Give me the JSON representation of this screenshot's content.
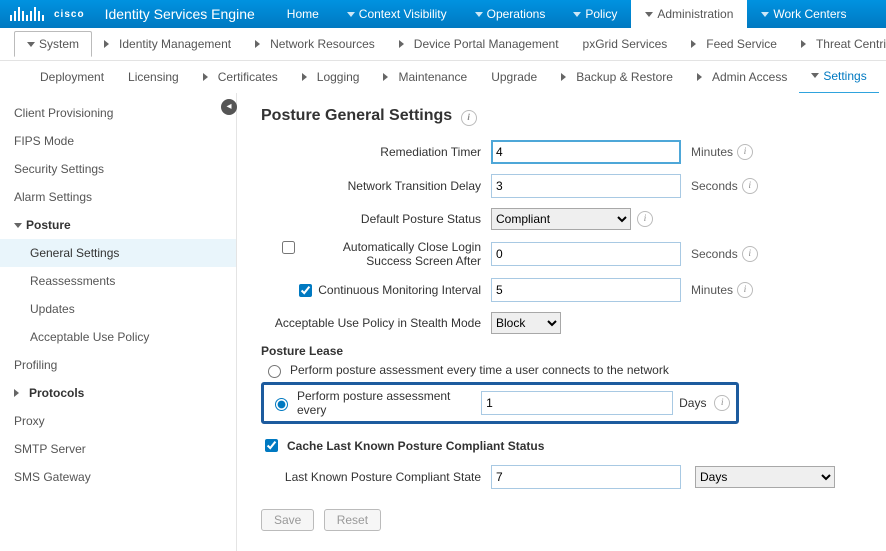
{
  "brand": {
    "vendor": "cisco",
    "product": "Identity Services Engine"
  },
  "topnav": {
    "items": [
      "Home",
      "Context Visibility",
      "Operations",
      "Policy",
      "Administration",
      "Work Centers"
    ],
    "active": "Administration"
  },
  "subnav": {
    "items": [
      "System",
      "Identity Management",
      "Network Resources",
      "Device Portal Management",
      "pxGrid Services",
      "Feed Service",
      "Threat Centric NAC"
    ],
    "active": "System",
    "dropdowns": [
      true,
      true,
      true,
      true,
      false,
      true,
      true
    ]
  },
  "ternav": {
    "items": [
      "Deployment",
      "Licensing",
      "Certificates",
      "Logging",
      "Maintenance",
      "Upgrade",
      "Backup & Restore",
      "Admin Access",
      "Settings"
    ],
    "active": "Settings",
    "dropdowns": [
      false,
      false,
      true,
      true,
      true,
      false,
      true,
      true,
      true
    ]
  },
  "sidebar": {
    "items": [
      {
        "label": "Client Provisioning",
        "type": "item"
      },
      {
        "label": "FIPS Mode",
        "type": "item"
      },
      {
        "label": "Security Settings",
        "type": "item"
      },
      {
        "label": "Alarm Settings",
        "type": "item"
      },
      {
        "label": "Posture",
        "type": "group",
        "expanded": true,
        "children": [
          {
            "label": "General Settings",
            "active": true
          },
          {
            "label": "Reassessments"
          },
          {
            "label": "Updates"
          },
          {
            "label": "Acceptable Use Policy"
          }
        ]
      },
      {
        "label": "Profiling",
        "type": "item"
      },
      {
        "label": "Protocols",
        "type": "group",
        "expanded": false
      },
      {
        "label": "Proxy",
        "type": "item"
      },
      {
        "label": "SMTP Server",
        "type": "item"
      },
      {
        "label": "SMS Gateway",
        "type": "item"
      }
    ]
  },
  "page": {
    "title": "Posture General Settings",
    "fields": {
      "remediation_timer": {
        "label": "Remediation Timer",
        "value": "4",
        "unit": "Minutes"
      },
      "network_transition_delay": {
        "label": "Network Transition Delay",
        "value": "3",
        "unit": "Seconds"
      },
      "default_posture_status": {
        "label": "Default Posture Status",
        "value": "Compliant"
      },
      "auto_close": {
        "label": "Automatically Close Login Success Screen After",
        "checked": false,
        "value": "0",
        "unit": "Seconds"
      },
      "continuous_monitoring": {
        "label": "Continuous Monitoring Interval",
        "checked": true,
        "value": "5",
        "unit": "Minutes"
      },
      "aup_stealth": {
        "label": "Acceptable Use Policy in Stealth Mode",
        "value": "Block"
      }
    },
    "posture_lease": {
      "title": "Posture Lease",
      "option_always": "Perform posture assessment every time a user connects to the network",
      "option_every": "Perform posture assessment every",
      "every_value": "1",
      "every_unit": "Days",
      "selected": "every"
    },
    "cache": {
      "checkbox_label": "Cache Last Known Posture Compliant Status",
      "checked": true,
      "state_label": "Last Known Posture Compliant State",
      "state_value": "7",
      "state_unit": "Days"
    },
    "buttons": {
      "save": "Save",
      "reset": "Reset"
    }
  }
}
